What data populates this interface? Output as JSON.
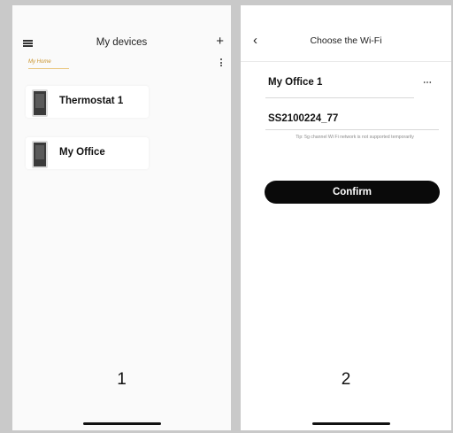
{
  "screen1": {
    "title": "My devices",
    "home_tag": "My Home",
    "devices": [
      {
        "name": "Thermostat 1"
      },
      {
        "name": "My Office"
      }
    ],
    "step_number": "1",
    "icons": {
      "menu": "menu-icon",
      "add": "plus-icon",
      "more": "kebab-icon",
      "device": "thermostat-icon"
    }
  },
  "screen2": {
    "title": "Choose the Wi-Fi",
    "wifi_name": "My Office 1",
    "wifi_password": "SS2100224_77",
    "tip": "Tip: 5g channel Wi Fi network is not supported temporarily",
    "confirm_label": "Confirm",
    "step_number": "2",
    "icons": {
      "back": "back-icon",
      "more": "more-icon"
    }
  },
  "colors": {
    "accent": "#c9922a",
    "button": "#0a0a0a",
    "background": "#c9c9c9"
  }
}
